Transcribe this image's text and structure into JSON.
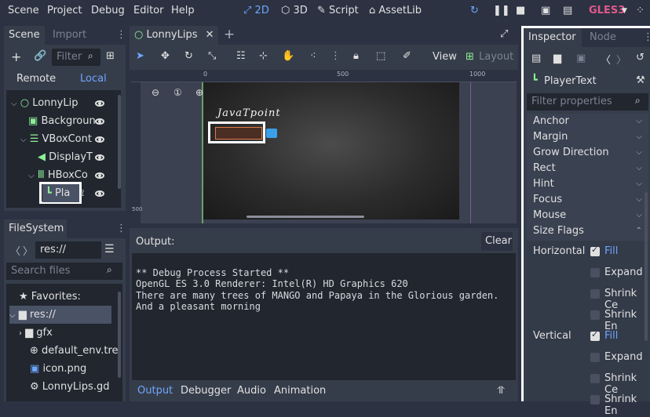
{
  "menu": {
    "items": [
      "Scene",
      "Project",
      "Debug",
      "Editor",
      "Help"
    ],
    "modes": [
      "2D",
      "3D",
      "Script",
      "AssetLib"
    ],
    "renderer": "GLES3"
  },
  "scene_dock": {
    "tabs": [
      "Scene",
      "Import"
    ],
    "filter_placeholder": "Filter",
    "remote": "Remote",
    "local": "Local",
    "nodes": [
      "LonnyLip",
      "Backgroun",
      "VBoxCont",
      "DisplayT",
      "HBoxCo",
      "Pla"
    ]
  },
  "filesystem": {
    "tab": "FileSystem",
    "path": "res://",
    "search_placeholder": "Search files",
    "items": [
      "Favorites:",
      "res://",
      "gfx",
      "default_env.tre",
      "icon.png",
      "LonnyLips.gd"
    ]
  },
  "editor": {
    "tab": "LonnyLips",
    "view": "View",
    "layout": "Layout",
    "ruler": [
      "0",
      "500",
      "1000"
    ],
    "ruler_side": "500",
    "canvas_text": "JavaTpoint"
  },
  "output": {
    "title": "Output:",
    "clear": "Clear",
    "lines": [
      "** Debug Process Started **",
      "OpenGL ES 3.0 Renderer: Intel(R) HD Graphics 620",
      "There are many trees of MANGO and Papaya in the Glorious garden.",
      "And a pleasant morning"
    ],
    "bottom_tabs": [
      "Output",
      "Debugger",
      "Audio",
      "Animation"
    ]
  },
  "inspector": {
    "tabs": [
      "Inspector",
      "Node"
    ],
    "node": "PlayerText",
    "filter_placeholder": "Filter properties",
    "sections": [
      "Anchor",
      "Margin",
      "Grow Direction",
      "Rect",
      "Hint",
      "Focus",
      "Mouse",
      "Size Flags"
    ],
    "horizontal": "Horizontal",
    "vertical": "Vertical",
    "flags": [
      "Fill",
      "Expand",
      "Shrink Ce",
      "Shrink En"
    ]
  }
}
